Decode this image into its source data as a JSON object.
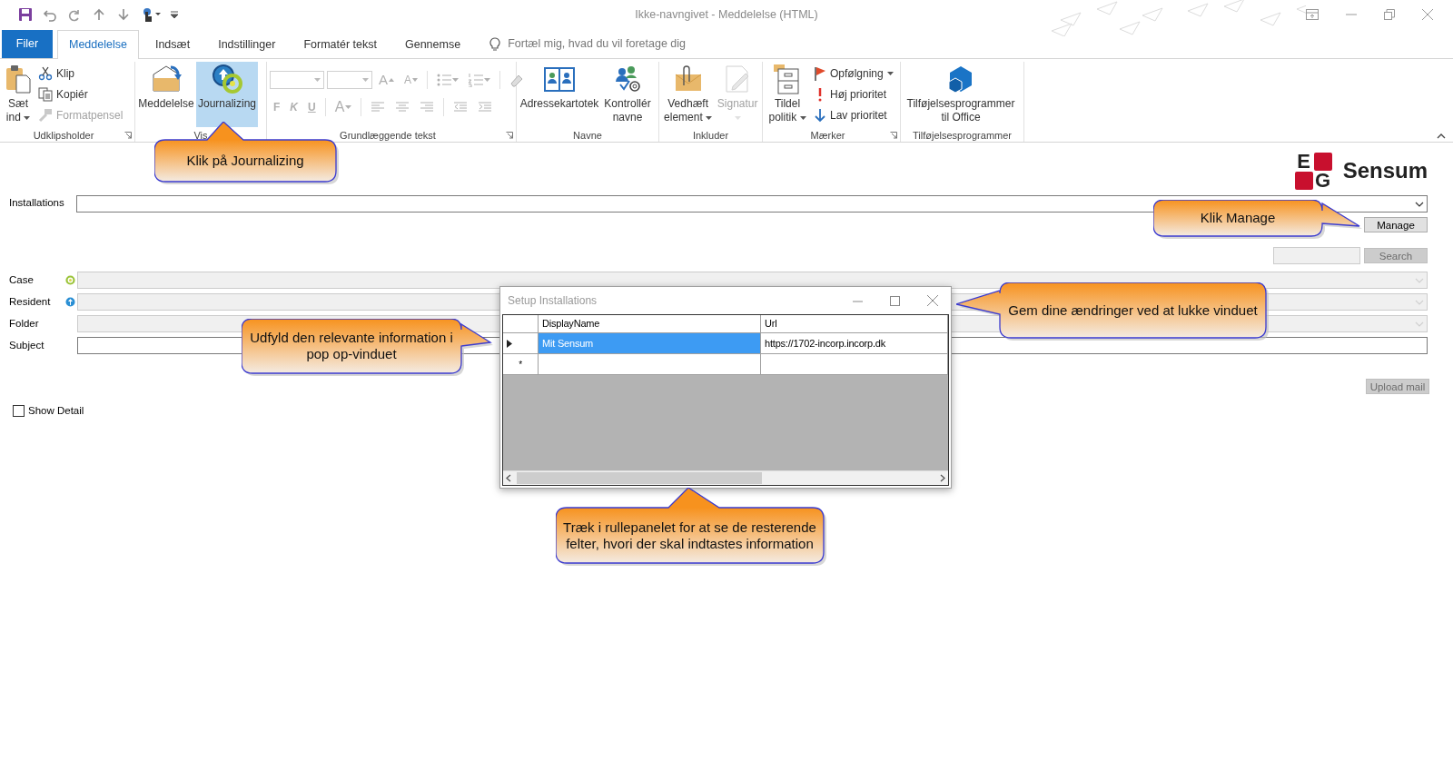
{
  "window": {
    "title": "Ikke-navngivet - Meddelelse (HTML)"
  },
  "tabs": [
    {
      "label": "Filer",
      "kind": "file",
      "selected": false
    },
    {
      "label": "Meddelelse",
      "kind": "tab",
      "selected": true
    },
    {
      "label": "Indsæt",
      "kind": "tab",
      "selected": false
    },
    {
      "label": "Indstillinger",
      "kind": "tab",
      "selected": false
    },
    {
      "label": "Formatér tekst",
      "kind": "tab",
      "selected": false
    },
    {
      "label": "Gennemse",
      "kind": "tab",
      "selected": false
    }
  ],
  "tell_me": {
    "placeholder": "Fortæl mig, hvad du vil foretage dig"
  },
  "ribbon": {
    "groups": [
      {
        "label": "Udklipsholder",
        "kind": "buttons",
        "launcher": true,
        "items": [
          {
            "kind": "large",
            "label": "Sæt ind",
            "dropdown": true,
            "disabled": false,
            "selected": false
          },
          {
            "kind": "small",
            "label": "Klip",
            "dropdown": false,
            "disabled": false,
            "selected": false
          },
          {
            "kind": "small",
            "label": "Kopiér",
            "dropdown": false,
            "disabled": false,
            "selected": false
          },
          {
            "kind": "small",
            "label": "Formatpensel",
            "dropdown": false,
            "disabled": true,
            "selected": false
          }
        ]
      },
      {
        "label": "Vis",
        "kind": "buttons",
        "launcher": false,
        "items": [
          {
            "kind": "large",
            "label": "Meddelelse",
            "dropdown": false,
            "disabled": false,
            "selected": false
          },
          {
            "kind": "large",
            "label": "Journalizing",
            "dropdown": false,
            "disabled": false,
            "selected": true
          }
        ]
      },
      {
        "label": "Grundlæggende tekst",
        "kind": "font",
        "launcher": true,
        "disabled": true,
        "size_buttons": [
          {
            "label": "A",
            "kind": "grow"
          },
          {
            "label": "A",
            "kind": "shrink"
          }
        ],
        "format_buttons": [
          {
            "label": "F",
            "kind": "bold"
          },
          {
            "label": "K",
            "kind": "italic"
          },
          {
            "label": "U",
            "kind": "underline"
          }
        ],
        "font_color": {
          "label": "A",
          "dropdown": true
        }
      },
      {
        "label": "Navne",
        "kind": "buttons",
        "launcher": false,
        "items": [
          {
            "kind": "large",
            "label": "Adressekartotek",
            "dropdown": false,
            "disabled": false,
            "selected": false
          },
          {
            "kind": "large",
            "label": "Kontrollér navne",
            "dropdown": false,
            "disabled": false,
            "selected": false
          }
        ]
      },
      {
        "label": "Inkluder",
        "kind": "buttons",
        "launcher": false,
        "items": [
          {
            "kind": "large",
            "label": "Vedhæft element",
            "dropdown": true,
            "disabled": false,
            "selected": false
          },
          {
            "kind": "large",
            "label": "Signatur",
            "dropdown": true,
            "disabled": true,
            "selected": false
          }
        ]
      },
      {
        "label": "Mærker",
        "kind": "buttons",
        "launcher": true,
        "items": [
          {
            "kind": "large",
            "label": "Tildel politik",
            "dropdown": true,
            "disabled": false,
            "selected": false
          },
          {
            "kind": "small",
            "label": "Opfølgning",
            "dropdown": true,
            "disabled": false,
            "selected": false
          },
          {
            "kind": "small",
            "label": "Høj prioritet",
            "dropdown": false,
            "disabled": false,
            "selected": false
          },
          {
            "kind": "small",
            "label": "Lav prioritet",
            "dropdown": false,
            "disabled": false,
            "selected": false
          }
        ]
      },
      {
        "label": "Tilføjelsesprogrammer",
        "kind": "buttons",
        "launcher": false,
        "items": [
          {
            "kind": "large",
            "label": "Tilføjelsesprogrammer til Office",
            "dropdown": false,
            "disabled": false,
            "selected": false
          }
        ]
      }
    ]
  },
  "form": {
    "logo": {
      "letters": [
        "E",
        "G"
      ],
      "name": "Sensum"
    },
    "installations": {
      "label": "Installations"
    },
    "manage_button": {
      "label": "Manage"
    },
    "search": {
      "button": "Search",
      "disabled": true
    },
    "fields": [
      {
        "label": "Case",
        "kind": "combo",
        "disabled": true
      },
      {
        "label": "Resident",
        "kind": "combo",
        "disabled": true
      },
      {
        "label": "Folder",
        "kind": "combo",
        "disabled": true
      },
      {
        "label": "Subject",
        "kind": "text",
        "disabled": false
      }
    ],
    "upload_button": {
      "label": "Upload mail",
      "disabled": true
    },
    "show_detail": {
      "label": "Show Detail",
      "checked": false
    }
  },
  "dialog": {
    "title": "Setup Installations",
    "columns": [
      "DisplayName",
      "Url"
    ],
    "rows": [
      {
        "current": true,
        "cells": [
          {
            "text": "Mit Sensum",
            "selected": true
          },
          {
            "text": "https://1702-incorp.incorp.dk",
            "selected": false
          }
        ]
      }
    ],
    "new_row": {
      "marker": "*"
    }
  },
  "callouts": [
    {
      "text": "Klik på Journalizing"
    },
    {
      "text": "Klik Manage"
    },
    {
      "text": "Gem dine ændringer ved at lukke vinduet"
    },
    {
      "text": "Udfyld den relevante information i pop op-vinduet"
    },
    {
      "text": "Træk i rullepanelet for at se de resterende felter, hvori der skal indtastes information"
    }
  ]
}
